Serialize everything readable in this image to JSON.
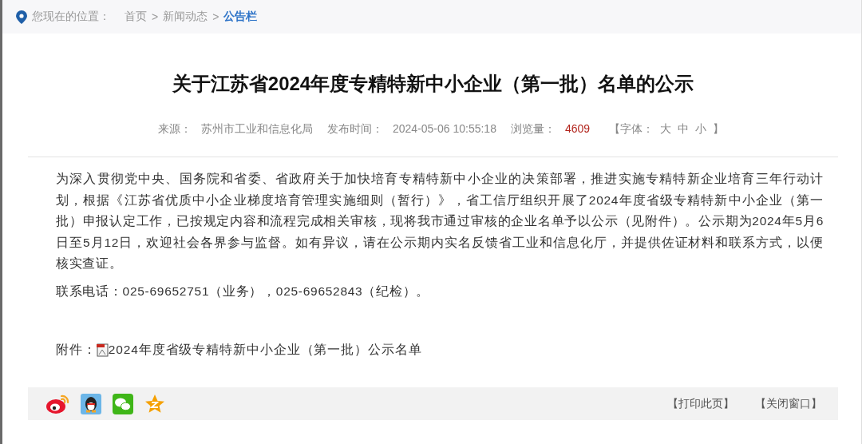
{
  "breadcrumb": {
    "label": "您现在的位置：",
    "items": [
      {
        "text": "首页",
        "selected": false,
        "separator": ">"
      },
      {
        "text": "新闻动态",
        "selected": false,
        "separator": ">"
      },
      {
        "text": "公告栏",
        "selected": true
      }
    ]
  },
  "article": {
    "title": "关于江苏省2024年度专精特新中小企业（第一批）名单的公示",
    "meta": [
      {
        "label": "来源：",
        "value": "苏州市工业和信息化局",
        "kind": "plain"
      },
      {
        "label": "发布时间：",
        "value": "2024-05-06 10:55:18",
        "kind": "plain"
      },
      {
        "label": "浏览量：",
        "value": "4609",
        "kind": "count"
      }
    ],
    "font_size": {
      "open": "【字体：",
      "options": [
        "大",
        "中",
        "小"
      ],
      "close": "】"
    },
    "paragraphs": [
      "为深入贯彻党中央、国务院和省委、省政府关于加快培育专精特新中小企业的决策部署，推进实施专精特新企业培育三年行动计划，根据《江苏省优质中小企业梯度培育管理实施细则（暂行）》，省工信厅组织开展了2024年度省级专精特新中小企业（第一批）申报认定工作，已按规定内容和流程完成相关审核，现将我市通过审核的企业名单予以公示（见附件）。公示期为2024年5月6日至5月12日，欢迎社会各界参与监督。如有异议，请在公示期内实名反馈省工业和信息化厅，并提供佐证材料和联系方式，以便核实查证。",
      "联系电话：025-69652751（业务），025-69652843（纪检）。"
    ],
    "attachment": {
      "label": "附件：",
      "file": "2024年度省级专精特新中小企业（第一批）公示名单"
    }
  },
  "footer": {
    "share": [
      {
        "kind": "weibo"
      },
      {
        "kind": "qq"
      },
      {
        "kind": "wechat"
      },
      {
        "kind": "qzone"
      }
    ],
    "links": [
      "【打印此页】",
      "【关闭窗口】"
    ]
  }
}
